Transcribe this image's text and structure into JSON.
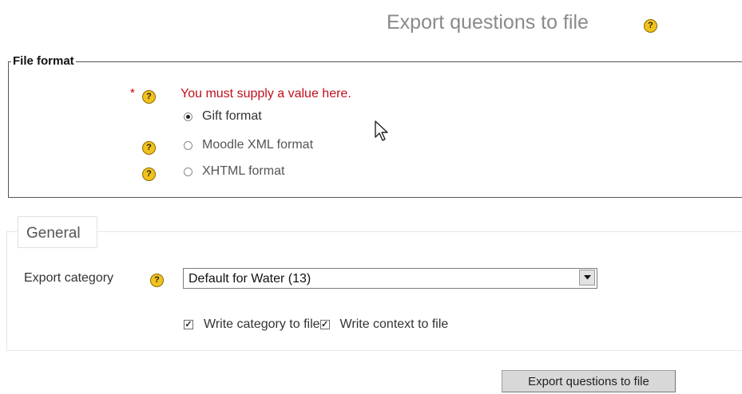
{
  "page": {
    "title": "Export questions to file"
  },
  "file_format": {
    "legend": "File format",
    "required_marker": "*",
    "error_message": "You must supply a value here.",
    "options": [
      {
        "label": "Gift format",
        "checked": true
      },
      {
        "label": "Moodle XML format",
        "checked": false
      },
      {
        "label": "XHTML format",
        "checked": false
      }
    ]
  },
  "general": {
    "legend": "General",
    "export_category_label": "Export category",
    "export_category_value": "Default for Water (13)",
    "checkboxes": [
      {
        "label": "Write category to file",
        "checked": true
      },
      {
        "label": "Write context to file",
        "checked": true
      }
    ]
  },
  "actions": {
    "submit_label": "Export questions to file"
  },
  "icons": {
    "help": "help-icon",
    "help_glyph": "?",
    "cursor": "mouse-pointer-icon",
    "dropdown": "chevron-down-icon"
  },
  "colors": {
    "error": "#c0101b",
    "help_icon": "#f1c21b"
  }
}
